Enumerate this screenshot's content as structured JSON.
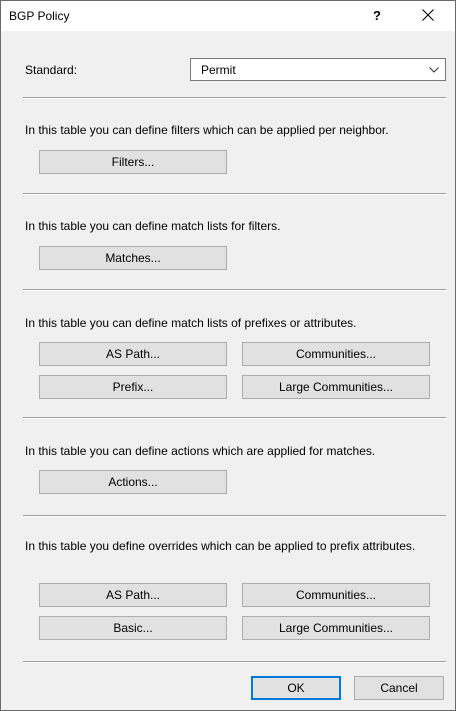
{
  "window": {
    "title": "BGP Policy",
    "help_label": "?",
    "close_icon": "close-icon"
  },
  "standard": {
    "label": "Standard:",
    "selected": "Permit"
  },
  "sections": {
    "filters": {
      "description": "In this table you can define filters which can be applied per neighbor.",
      "button": "Filters..."
    },
    "matches": {
      "description": "In this table you can define match lists for filters.",
      "button": "Matches..."
    },
    "match_lists": {
      "description": "In this table you can define match lists of prefixes or attributes.",
      "as_path": "AS Path...",
      "communities": "Communities...",
      "prefix": "Prefix...",
      "large_communities": "Large Communities..."
    },
    "actions": {
      "description": "In this table you can define actions which are applied for matches.",
      "button": "Actions..."
    },
    "overrides": {
      "description": "In this table you define overrides which can be applied to prefix attributes.",
      "as_path": "AS Path...",
      "communities": "Communities...",
      "basic": "Basic...",
      "large_communities": "Large Communities..."
    }
  },
  "footer": {
    "ok": "OK",
    "cancel": "Cancel"
  },
  "colors": {
    "dialog_background": "#f0f0f0",
    "titlebar_background": "#ffffff",
    "button_face": "#e1e1e1",
    "default_button_border": "#0078d7"
  }
}
